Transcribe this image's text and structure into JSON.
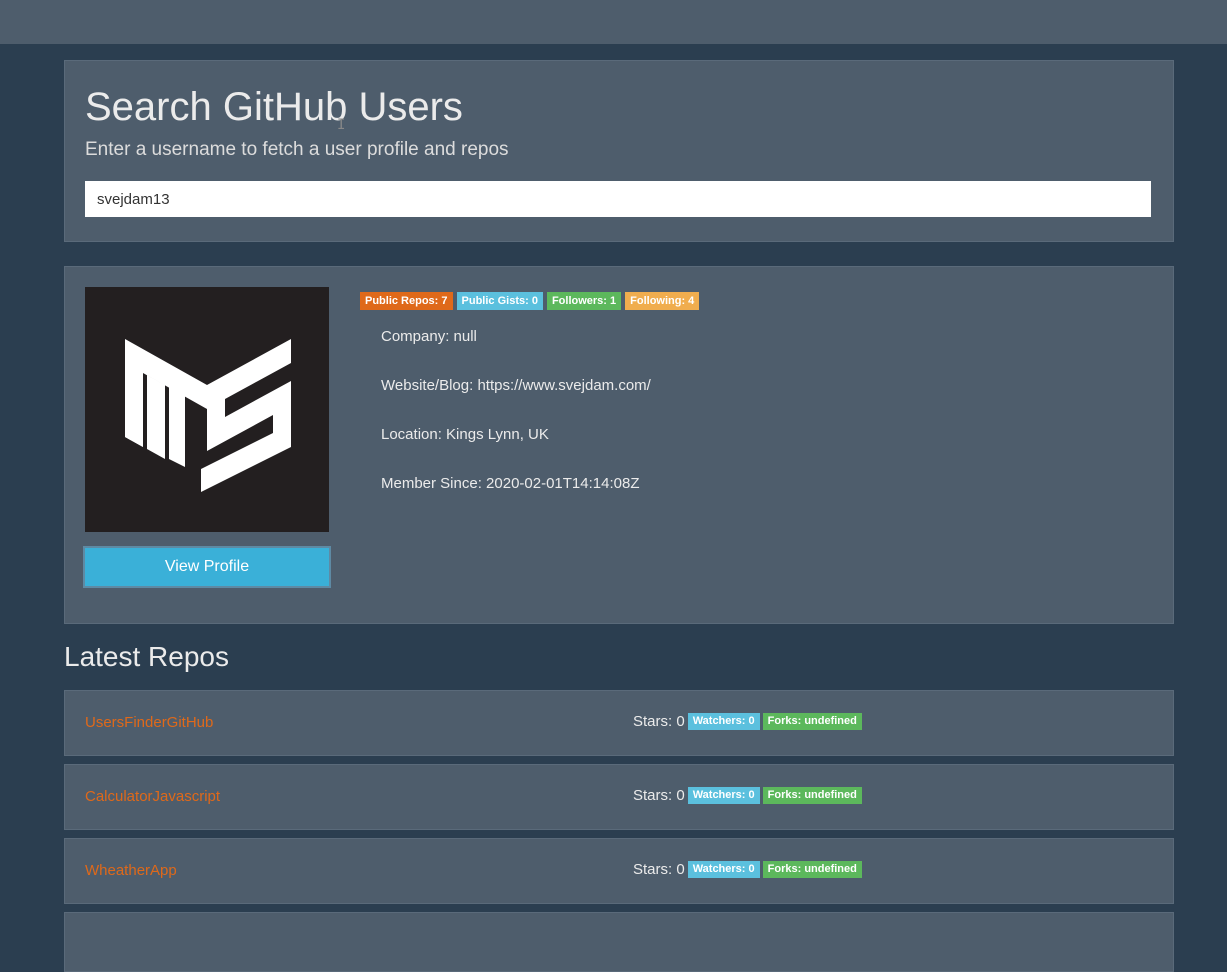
{
  "search": {
    "title": "Search GitHub Users",
    "subtitle": "Enter a username to fetch a user profile and repos",
    "value": "svejdam13"
  },
  "profile": {
    "view_button": "View Profile",
    "badges": {
      "repos": "Public Repos: 7",
      "gists": "Public Gists: 0",
      "followers": "Followers: 1",
      "following": "Following: 4"
    },
    "info": {
      "company": "Company: null",
      "website": "Website/Blog: https://www.svejdam.com/",
      "location": "Location: Kings Lynn, UK",
      "member_since": "Member Since: 2020-02-01T14:14:08Z"
    }
  },
  "repos": {
    "title": "Latest Repos",
    "items": [
      {
        "name": "UsersFinderGitHub",
        "stars": "Stars: 0",
        "watchers": "Watchers: 0",
        "forks": "Forks: undefined"
      },
      {
        "name": "CalculatorJavascript",
        "stars": "Stars: 0",
        "watchers": "Watchers: 0",
        "forks": "Forks: undefined"
      },
      {
        "name": "WheatherApp",
        "stars": "Stars: 0",
        "watchers": "Watchers: 0",
        "forks": "Forks: undefined"
      }
    ]
  },
  "colors": {
    "background": "#2b3e50",
    "panel": "#4e5d6c",
    "primary": "#df691a",
    "info": "#5bc0de",
    "success": "#5cb85c",
    "warning": "#f0ad4e"
  },
  "icons": {
    "avatar": "ms-logo-icon",
    "cursor": "text-cursor-icon"
  }
}
